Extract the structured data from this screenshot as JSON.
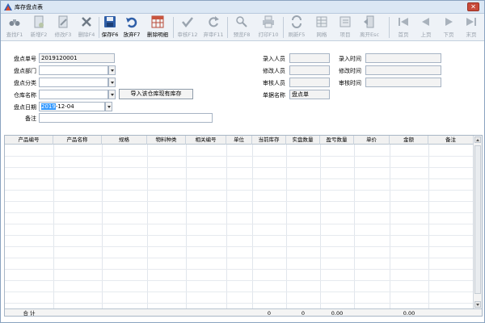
{
  "window": {
    "title": "库存盘点表"
  },
  "toolbar": {
    "buttons": [
      {
        "label": "查找F1",
        "icon": "binoculars-icon",
        "state": "disabled"
      },
      {
        "label": "新增F2",
        "icon": "new-document-icon",
        "state": "disabled"
      },
      {
        "label": "修改F3",
        "icon": "edit-document-icon",
        "state": "disabled"
      },
      {
        "label": "删除F4",
        "icon": "delete-x-icon",
        "state": "disabled"
      },
      {
        "label": "保存F6",
        "icon": "save-disk-icon",
        "state": "enabled"
      },
      {
        "label": "放弃F7",
        "icon": "undo-arrow-icon",
        "state": "enabled"
      },
      {
        "label": "删除明细",
        "icon": "grid-delete-icon",
        "state": "enabled"
      },
      {
        "label": "审核F12",
        "icon": "checkmark-icon",
        "state": "disabled"
      },
      {
        "label": "弃审F11",
        "icon": "refresh-arrow-icon",
        "state": "disabled"
      },
      {
        "label": "预览F8",
        "icon": "preview-magnifier-icon",
        "state": "disabled"
      },
      {
        "label": "打印F10",
        "icon": "printer-icon",
        "state": "disabled"
      },
      {
        "label": "刷新F5",
        "icon": "refresh-icon",
        "state": "disabled"
      },
      {
        "label": "网格",
        "icon": "grid-icon",
        "state": "disabled"
      },
      {
        "label": "项目",
        "icon": "project-book-icon",
        "state": "disabled"
      },
      {
        "label": "离开Esc",
        "icon": "exit-door-icon",
        "state": "disabled"
      },
      {
        "label": "首页",
        "icon": "first-page-icon",
        "state": "disabled"
      },
      {
        "label": "上页",
        "icon": "prev-page-icon",
        "state": "disabled"
      },
      {
        "label": "下页",
        "icon": "next-page-icon",
        "state": "disabled"
      },
      {
        "label": "末页",
        "icon": "last-page-icon",
        "state": "disabled"
      }
    ]
  },
  "form": {
    "inventory_no_label": "盘点单号",
    "inventory_no_value": "2019120001",
    "dept_label": "盘点部门",
    "dept_value": "",
    "category_label": "盘点分类",
    "category_value": "",
    "warehouse_label": "仓库名称",
    "warehouse_value": "",
    "import_button": "导入该仓库现有库存",
    "date_label": "盘点日期",
    "date_year": "2019",
    "date_rest": "-12-04",
    "remark_label": "备注",
    "remark_value": "",
    "entered_by_label": "录入人员",
    "entered_by_value": "",
    "modified_by_label": "修改人员",
    "modified_by_value": "",
    "reviewed_by_label": "审核人员",
    "reviewed_by_value": "",
    "doc_name_label": "单据名称",
    "doc_name_value": "盘点单",
    "entered_time_label": "录入时间",
    "entered_time_value": "",
    "modified_time_label": "修改时间",
    "modified_time_value": "",
    "reviewed_time_label": "审核时间",
    "reviewed_time_value": ""
  },
  "grid": {
    "columns": [
      "产品编号",
      "产品名称",
      "规格",
      "物料种类",
      "相关编号",
      "单位",
      "当前库存",
      "实盘数量",
      "盈亏数量",
      "单价",
      "金额",
      "备注"
    ],
    "footer": {
      "total_label": "合 计",
      "current_stock": "0",
      "counted_qty": "0",
      "diff_qty": "0.00",
      "amount": "0.00"
    }
  },
  "colors": {
    "accent": "#3399ff",
    "close": "#c84a3a",
    "toolbar_bg": "#eef2f7"
  }
}
